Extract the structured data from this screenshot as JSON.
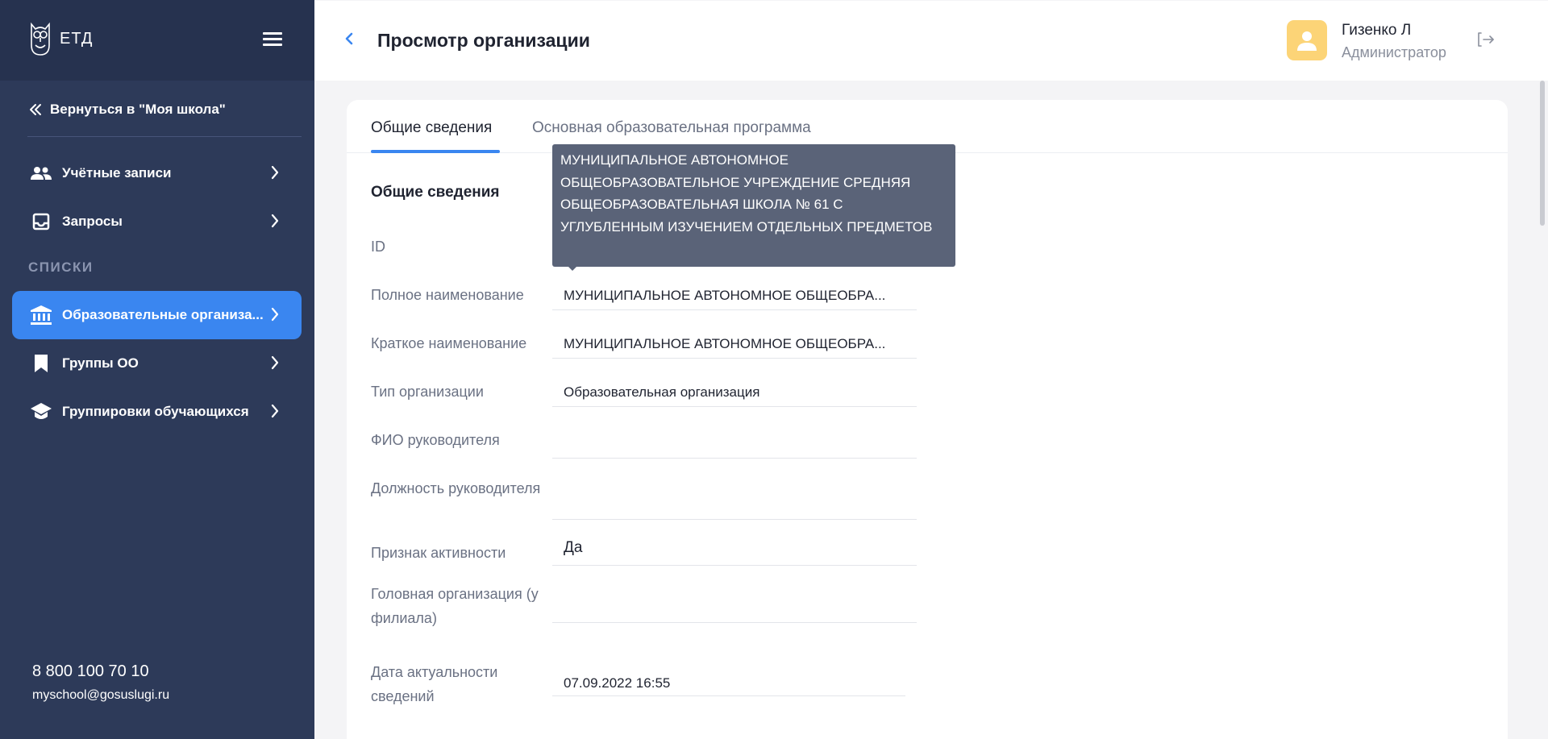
{
  "sidebar": {
    "logo_text": "ЕТД",
    "back_label": "Вернуться в \"Моя школа\"",
    "section_label": "СПИСКИ",
    "items": [
      {
        "label": "Учётные записи",
        "icon": "users-icon"
      },
      {
        "label": "Запросы",
        "icon": "inbox-icon"
      },
      {
        "label": "Образовательные организа...",
        "icon": "institution-icon",
        "active": true
      },
      {
        "label": "Группы ОО",
        "icon": "bookmark-icon"
      },
      {
        "label": "Группировки обучающихся",
        "icon": "graduation-cap-icon"
      }
    ],
    "phone": "8 800 100 70 10",
    "email": "myschool@gosuslugi.ru"
  },
  "header": {
    "title": "Просмотр организации",
    "user_name": "Гизенко Л",
    "user_role": "Администратор"
  },
  "tabs": [
    {
      "label": "Общие сведения",
      "active": true
    },
    {
      "label": "Основная образовательная программа",
      "active": false
    }
  ],
  "section": {
    "title": "Общие сведения"
  },
  "fields": [
    {
      "label": "ID",
      "value": ""
    },
    {
      "label": "Полное наименование",
      "value": "МУНИЦИПАЛЬНОЕ АВТОНОМНОЕ ОБЩЕОБРА..."
    },
    {
      "label": "Краткое наименование",
      "value": "МУНИЦИПАЛЬНОЕ АВТОНОМНОЕ ОБЩЕОБРА..."
    },
    {
      "label": "Тип организации",
      "value": "Образовательная организация"
    },
    {
      "label": "ФИО руководителя",
      "value": ""
    },
    {
      "label": "Должность руководителя",
      "value": ""
    },
    {
      "label": "Признак активности",
      "value": "Да"
    },
    {
      "label": "Головная организация (у филиала)",
      "value": ""
    },
    {
      "label": "Дата актуальности сведений",
      "value": "07.09.2022 16:55"
    }
  ],
  "tooltip": {
    "text": "МУНИЦИПАЛЬНОЕ АВТОНОМНОЕ ОБЩЕОБРАЗОВАТЕЛЬНОЕ УЧРЕЖДЕНИЕ СРЕДНЯЯ ОБЩЕОБРАЗОВАТЕЛЬНАЯ ШКОЛА № 61 С УГЛУБЛЕННЫМ ИЗУЧЕНИЕМ ОТДЕЛЬНЫХ ПРЕДМЕТОВ"
  },
  "colors": {
    "sidebar_bg": "#2d3a59",
    "accent": "#3a86f0",
    "avatar_bg": "#fcd477",
    "tooltip_bg": "#5a6378"
  }
}
